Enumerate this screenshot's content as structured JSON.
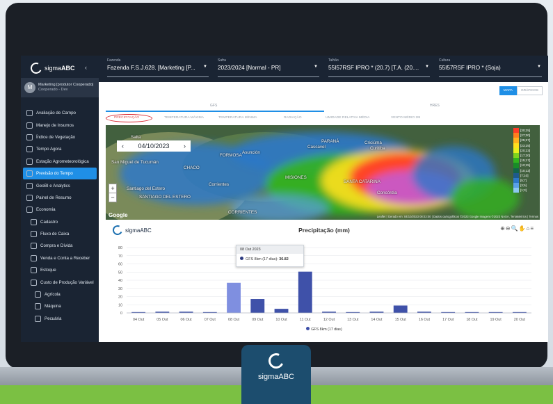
{
  "brand": {
    "name_light": "sigma",
    "name_bold": "ABC",
    "collapse_icon": "chevron-left-icon"
  },
  "user": {
    "initial": "M",
    "name": "Marketing [produtor Cooperado]",
    "role": "Cooperado - Dev"
  },
  "menu": [
    {
      "label": "Avaliação de Campo",
      "icon": "field-icon",
      "level": 0
    },
    {
      "label": "Manejo de Insumos",
      "icon": "inputs-icon",
      "level": 0
    },
    {
      "label": "Índice de Vegetação",
      "icon": "vegetation-icon",
      "level": 0
    },
    {
      "label": "Tempo Agora",
      "icon": "weather-icon",
      "level": 0
    },
    {
      "label": "Estação Agrometeorológica",
      "icon": "station-icon",
      "level": 0
    },
    {
      "label": "Previsão do Tempo",
      "icon": "forecast-icon",
      "level": 0,
      "active": true
    },
    {
      "label": "GeoBI e Analytics",
      "icon": "analytics-icon",
      "level": 0
    },
    {
      "label": "Painel de Resumo",
      "icon": "dashboard-icon",
      "level": 0
    },
    {
      "label": "Economia",
      "icon": "economy-icon",
      "level": 0
    },
    {
      "label": "Cadastro",
      "icon": "register-icon",
      "level": 1
    },
    {
      "label": "Fluxo de Caixa",
      "icon": "cashflow-icon",
      "level": 1
    },
    {
      "label": "Compra e Dívida",
      "icon": "purchase-icon",
      "level": 1
    },
    {
      "label": "Venda e Conta a Receber",
      "icon": "sales-icon",
      "level": 1
    },
    {
      "label": "Estoque",
      "icon": "stock-icon",
      "level": 1
    },
    {
      "label": "Custo de Produção Variável",
      "icon": "cost-icon",
      "level": 1
    },
    {
      "label": "Agrícola",
      "icon": "agri-icon",
      "level": 2
    },
    {
      "label": "Máquina",
      "icon": "machine-icon",
      "level": 2
    },
    {
      "label": "Pecuária",
      "icon": "cattle-icon",
      "level": 2
    }
  ],
  "selectors": [
    {
      "label": "Fazenda",
      "value": "Fazenda F.S.J.628. [Marketing [P..."
    },
    {
      "label": "Safra",
      "value": "2023/2024 [Normal - PR]"
    },
    {
      "label": "Talhão",
      "value": "55I57RSF IPRO * (20.7) [T.A. (20...."
    },
    {
      "label": "Cultura",
      "value": "55I57RSF IPRO * (Soja)"
    }
  ],
  "view_toggle": {
    "map": "MAPA",
    "charts": "GRÁFICOS"
  },
  "model_tabs": [
    "GFS",
    "HRES"
  ],
  "variable_tabs": [
    "PRECIPITAÇÃO",
    "TEMPERATURA MÁXIMA",
    "TEMPERATURA MÍNIMA",
    "RADIAÇÃO",
    "UMIDADE RELATIVA MÉDIA",
    "VENTO MÉDIO 2M"
  ],
  "map": {
    "date": "04/10/2023",
    "prev_icon": "‹",
    "next_icon": "›",
    "zoom_in": "+",
    "zoom_out": "−",
    "labels": [
      "Salta",
      "San Miguel de Tucumán",
      "CHACO",
      "FORMOSA",
      "Asunción",
      "Cascavel",
      "PARANÁ",
      "Criciúma",
      "Santiago del Estero",
      "SANTIAGO DEL ESTERO",
      "Corrientes",
      "CORRIENTES",
      "SANTA CATARINA",
      "MISIONES",
      "Concórdia",
      "Curitiba"
    ],
    "legend": [
      "[30;25]",
      "[27;30]",
      "[25;27]",
      "[23;25]",
      "[20;23]",
      "[17;20]",
      "[15;17]",
      "[12;15]",
      "[10;12]",
      "[7;10]",
      "[5;7]",
      "[3;5]",
      "[1;3]"
    ],
    "legend_colors": [
      "#ff3c28",
      "#ff7e1e",
      "#ffb21e",
      "#ffe01e",
      "#e6f01e",
      "#7fd21e",
      "#32b41e",
      "#198c28",
      "#14644b",
      "#1e5a8c",
      "#2d78c8",
      "#5aa0e6",
      "#8cc8f0"
    ],
    "attribution": "Leaflet | Gerado em: 04/10/2023 08:03:00 | Dados cartográficos ©2023 Google Imagens ©2023 NASA, TerraMetrics | Termos",
    "google": "Google"
  },
  "chart_data": {
    "type": "bar",
    "title": "Precipitação (mm)",
    "categories": [
      "04 Out",
      "05 Out",
      "06 Out",
      "07 Out",
      "08 Out",
      "09 Out",
      "10 Out",
      "11 Out",
      "12 Out",
      "13 Out",
      "14 Out",
      "15 Out",
      "16 Out",
      "17 Out",
      "18 Out",
      "19 Out",
      "20 Out"
    ],
    "series": [
      {
        "name": "GFS 8km (17 dias)",
        "values": [
          1,
          1.5,
          1.5,
          1,
          36.82,
          17,
          5,
          50.5,
          1.5,
          1,
          1.5,
          9,
          1.5,
          1,
          1,
          1,
          1
        ]
      }
    ],
    "ylim": [
      0,
      80
    ],
    "yticks": [
      0,
      10,
      20,
      30,
      40,
      50,
      60,
      70,
      80
    ],
    "highlighted_index": 4,
    "colors": {
      "bar": "#3f51a9",
      "highlight": "#7f8fe0"
    },
    "tooltip": {
      "header": "08 Out 2023",
      "series": "GFS 8km (17 dias):",
      "value": "36.82"
    },
    "legend": "GFS 8km (17 dias)",
    "logo_text": "sigmaABC",
    "tools": "⊕⊖🔍✋⌂≡"
  },
  "badge": {
    "text": "sigmaABC"
  }
}
